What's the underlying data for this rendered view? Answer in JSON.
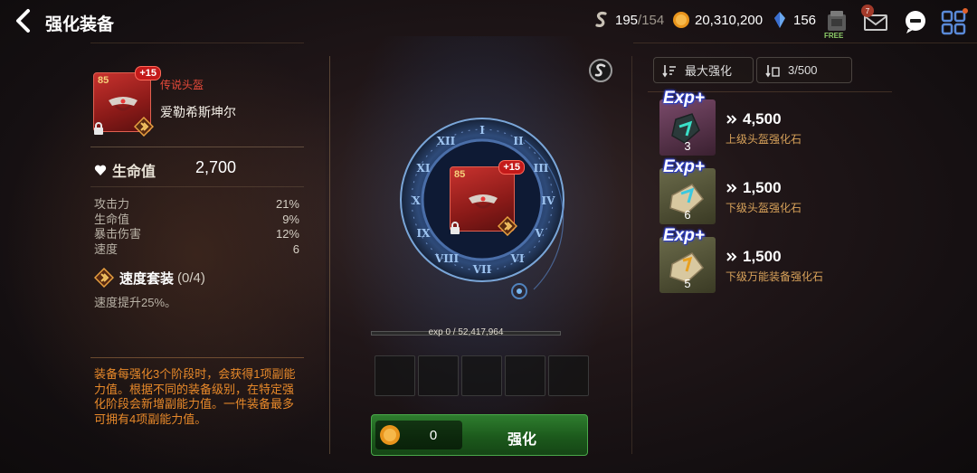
{
  "header": {
    "title": "强化装备",
    "resources": {
      "stigma": {
        "current": "195",
        "max": "/154"
      },
      "gold": "20,310,200",
      "crystal": "156"
    },
    "shop_free_label": "FREE",
    "mail_badge": "7"
  },
  "item": {
    "level": "85",
    "enhance": "+15",
    "rarity": "传说头盔",
    "name": "爱勒希斯坤尔",
    "main_stat": {
      "label": "生命值",
      "value": "2,700"
    },
    "substats": [
      {
        "label": "攻击力",
        "value": "21%"
      },
      {
        "label": "生命值",
        "value": "9%"
      },
      {
        "label": "暴击伤害",
        "value": "12%"
      },
      {
        "label": "速度",
        "value": "6"
      }
    ],
    "set": {
      "name": "速度套装",
      "count": "(0/4)",
      "desc": "速度提升25%。"
    },
    "info": "装备每强化3个阶段时，会获得1项副能力值。根据不同的装备级别，在特定强化阶段会新增副能力值。一件装备最多可拥有4项副能力值。"
  },
  "center": {
    "card_level": "85",
    "card_enhance": "+15",
    "exp_text": "exp 0 / 52,417,964",
    "exp_progress": 0,
    "cost": "0",
    "enhance_label": "强化"
  },
  "right": {
    "sort_label": "最大强化",
    "count_label": "3/500",
    "materials": [
      {
        "exp_tag": "Exp+",
        "qty": "3",
        "cost": "4,500",
        "name": "上级头盔强化石"
      },
      {
        "exp_tag": "Exp+",
        "qty": "6",
        "cost": "1,500",
        "name": "下级头盔强化石"
      },
      {
        "exp_tag": "Exp+",
        "qty": "5",
        "cost": "1,500",
        "name": "下级万能装备强化石"
      }
    ]
  },
  "colors": {
    "rarity": "#e84a3a",
    "info_text": "#e8892a",
    "enhance_button": "#2e7d2e",
    "material_name": "#d8a25a"
  }
}
